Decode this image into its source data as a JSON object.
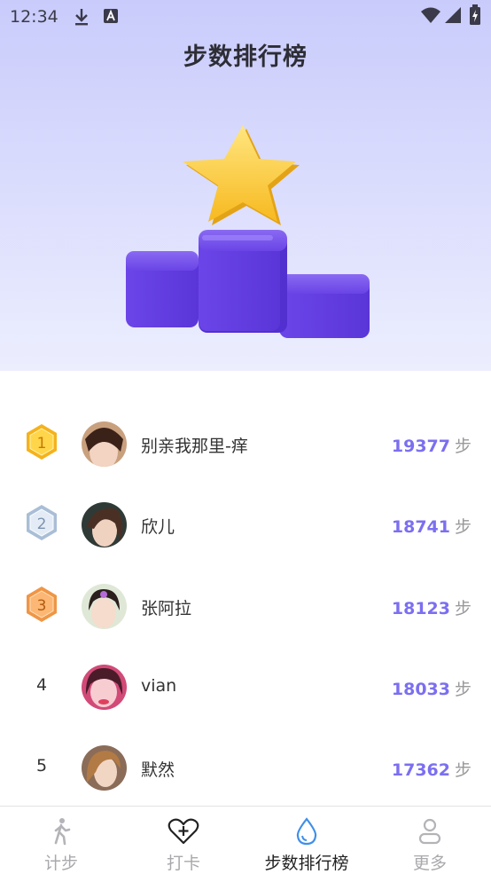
{
  "status": {
    "time": "12:34",
    "icons": [
      "download-icon",
      "font-a-icon",
      "wifi-icon",
      "signal-icon",
      "battery-icon"
    ]
  },
  "header": {
    "title": "步数排行榜"
  },
  "ranking": [
    {
      "rank": "1",
      "badge": "gold",
      "name": "别亲我那里-痒",
      "steps": "19377",
      "unit": "步"
    },
    {
      "rank": "2",
      "badge": "silver",
      "name": "欣儿",
      "steps": "18741",
      "unit": "步"
    },
    {
      "rank": "3",
      "badge": "bronze",
      "name": "张阿拉",
      "steps": "18123",
      "unit": "步"
    },
    {
      "rank": "4",
      "badge": "",
      "name": "vian",
      "steps": "18033",
      "unit": "步"
    },
    {
      "rank": "5",
      "badge": "",
      "name": "默然",
      "steps": "17362",
      "unit": "步"
    }
  ],
  "nav": {
    "items": [
      {
        "label": "计步",
        "icon": "walking-person-icon",
        "active": false
      },
      {
        "label": "打卡",
        "icon": "heart-plus-icon",
        "active": false
      },
      {
        "label": "步数排行榜",
        "icon": "water-drop-icon",
        "active": true
      },
      {
        "label": "更多",
        "icon": "person-outline-icon",
        "active": false
      }
    ]
  },
  "colors": {
    "accent": "#7b6ff0",
    "nav_active_icon": "#3f8fe8",
    "gold": "#f5b21c",
    "silver": "#a9bed6",
    "bronze": "#ef9646"
  }
}
